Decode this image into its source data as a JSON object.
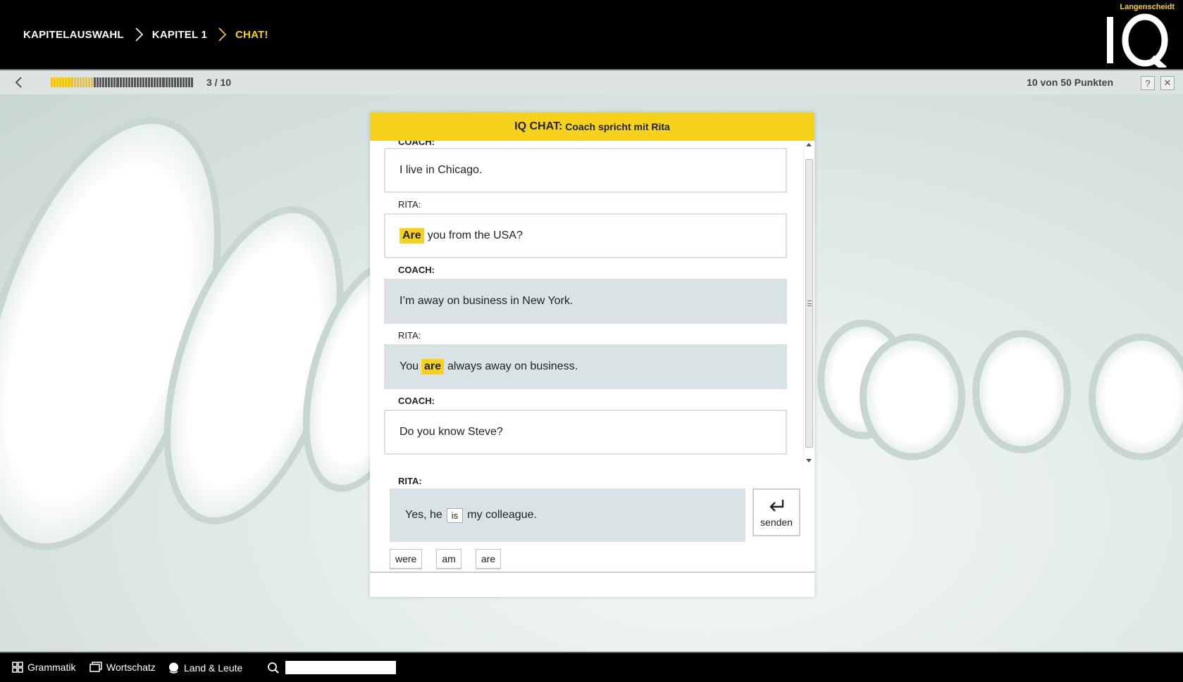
{
  "breadcrumb": [
    {
      "label": "KAPITELAUSWAHL"
    },
    {
      "label": "KAPITEL 1"
    },
    {
      "label": "CHAT!"
    }
  ],
  "logo": {
    "brand": "Langenscheidt",
    "mark": "IQ"
  },
  "progress": {
    "count_text": "3 / 10",
    "completed": 3,
    "total": 10
  },
  "score_text": "10 von 50 Punkten",
  "controls": {
    "help_label": "?",
    "close_label": "✕"
  },
  "chat": {
    "title_strong": "IQ CHAT:",
    "title_rest": "Coach spricht mit Rita",
    "partial_speaker": "COACH:",
    "messages": [
      {
        "speaker": "",
        "before": "I live in Chicago.",
        "highlight": "",
        "after": ""
      },
      {
        "speaker": "RITA:",
        "before": "",
        "highlight": "Are",
        "after": "you from the USA?"
      },
      {
        "speaker": "COACH:",
        "before": "I’m away on business in New York.",
        "highlight": "",
        "after": ""
      },
      {
        "speaker": "RITA:",
        "before": "You",
        "highlight": "are",
        "after": "always away on business."
      },
      {
        "speaker": "COACH:",
        "before": "Do you know Steve?",
        "highlight": "",
        "after": ""
      }
    ],
    "answer": {
      "speaker": "RITA:",
      "before": "Yes, he",
      "slot": "is",
      "after": "my colleague."
    },
    "send_label": "senden",
    "options": [
      "were",
      "am",
      "are"
    ]
  },
  "toolbar": {
    "grammatik": "Grammatik",
    "wortschatz": "Wortschatz",
    "land": "Land & Leute",
    "search_placeholder": ""
  },
  "colors": {
    "accent": "#f7d21c",
    "bubble_filled": "#d9e3e5"
  }
}
